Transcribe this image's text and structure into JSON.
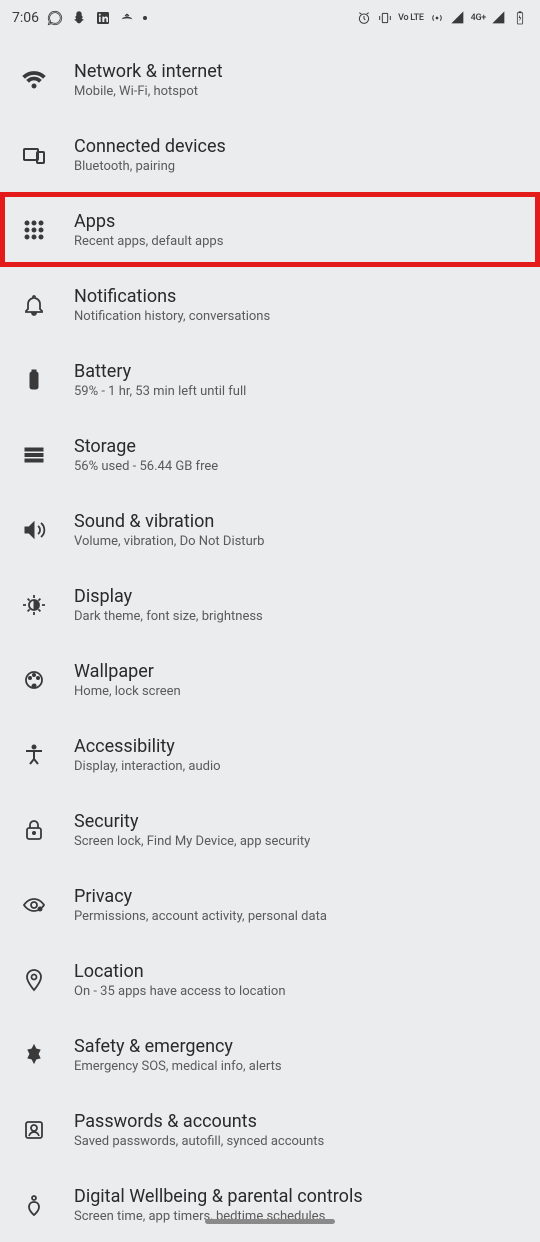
{
  "status": {
    "time": "7:06",
    "net_label": "4G+",
    "volte": "Vo LTE"
  },
  "settings": [
    {
      "icon": "wifi",
      "title": "Network & internet",
      "subtitle": "Mobile, Wi-Fi, hotspot",
      "highlighted": false
    },
    {
      "icon": "devices",
      "title": "Connected devices",
      "subtitle": "Bluetooth, pairing",
      "highlighted": false
    },
    {
      "icon": "apps",
      "title": "Apps",
      "subtitle": "Recent apps, default apps",
      "highlighted": true
    },
    {
      "icon": "bell",
      "title": "Notifications",
      "subtitle": "Notification history, conversations",
      "highlighted": false
    },
    {
      "icon": "battery",
      "title": "Battery",
      "subtitle": "59% - 1 hr, 53 min left until full",
      "highlighted": false
    },
    {
      "icon": "storage",
      "title": "Storage",
      "subtitle": "56% used - 56.44 GB free",
      "highlighted": false
    },
    {
      "icon": "sound",
      "title": "Sound & vibration",
      "subtitle": "Volume, vibration, Do Not Disturb",
      "highlighted": false
    },
    {
      "icon": "display",
      "title": "Display",
      "subtitle": "Dark theme, font size, brightness",
      "highlighted": false
    },
    {
      "icon": "wallpaper",
      "title": "Wallpaper",
      "subtitle": "Home, lock screen",
      "highlighted": false
    },
    {
      "icon": "accessibility",
      "title": "Accessibility",
      "subtitle": "Display, interaction, audio",
      "highlighted": false
    },
    {
      "icon": "lock",
      "title": "Security",
      "subtitle": "Screen lock, Find My Device, app security",
      "highlighted": false
    },
    {
      "icon": "privacy",
      "title": "Privacy",
      "subtitle": "Permissions, account activity, personal data",
      "highlighted": false
    },
    {
      "icon": "location",
      "title": "Location",
      "subtitle": "On - 35 apps have access to location",
      "highlighted": false
    },
    {
      "icon": "safety",
      "title": "Safety & emergency",
      "subtitle": "Emergency SOS, medical info, alerts",
      "highlighted": false
    },
    {
      "icon": "passwords",
      "title": "Passwords & accounts",
      "subtitle": "Saved passwords, autofill, synced accounts",
      "highlighted": false
    },
    {
      "icon": "wellbeing",
      "title": "Digital Wellbeing & parental controls",
      "subtitle": "Screen time, app timers, bedtime schedules",
      "highlighted": false
    }
  ]
}
